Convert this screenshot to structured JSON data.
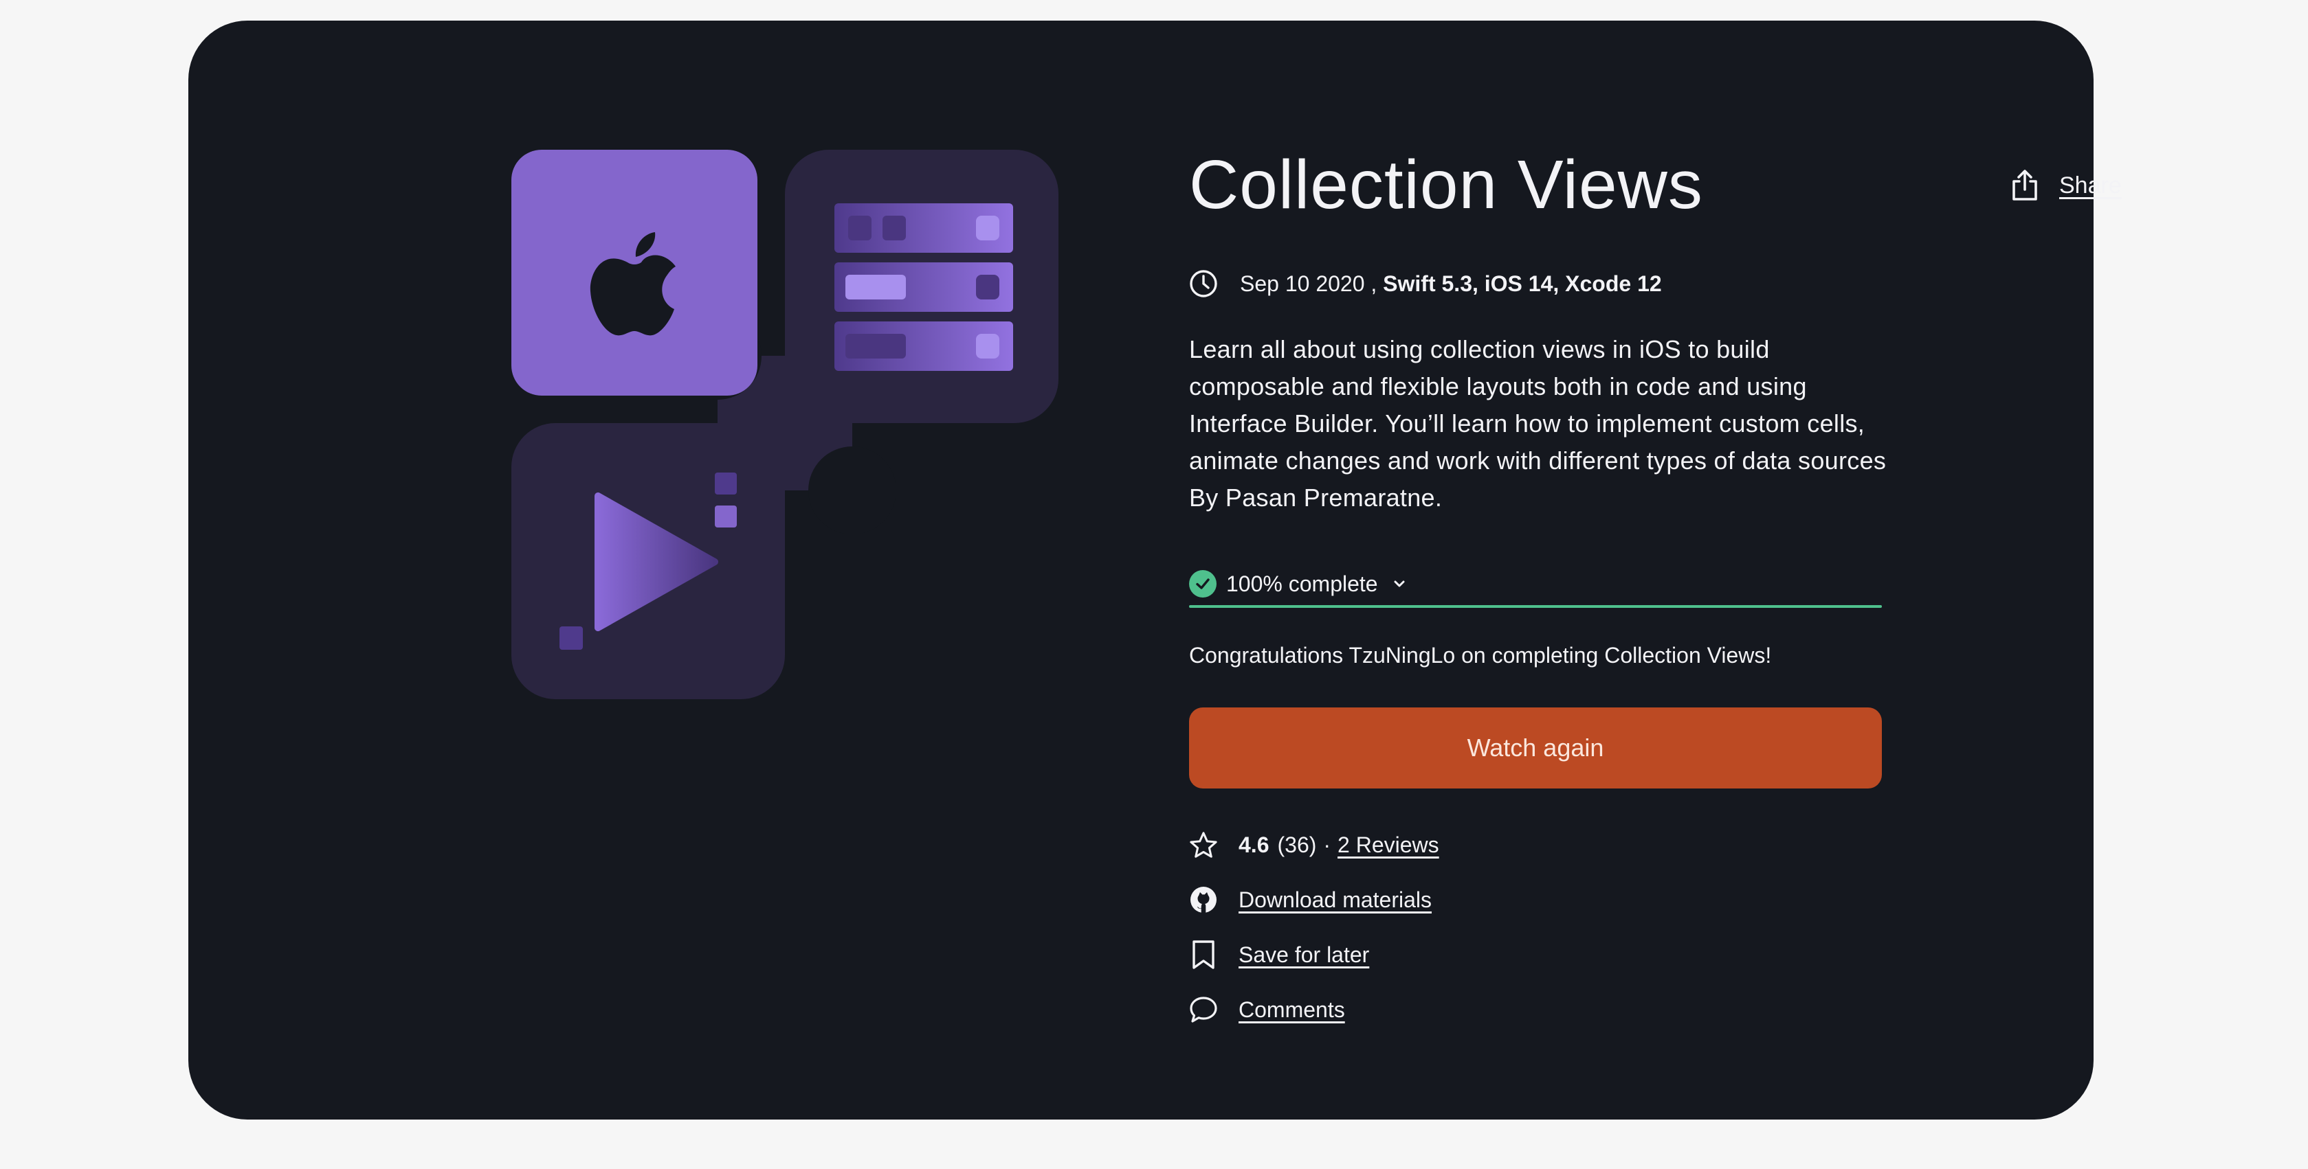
{
  "course": {
    "title": "Collection Views",
    "date": "Sep 10 2020",
    "date_separator": " , ",
    "technologies": "Swift 5.3, iOS 14, Xcode 12",
    "description": "Learn all about using collection views in iOS to build composable and flexible layouts both in code and using Interface Builder. You’ll learn how to implement custom cells, animate changes and work with different types of data sources By Pasan Premaratne."
  },
  "share": {
    "label": "Share",
    "icon": "share-icon"
  },
  "progress": {
    "label": "100% complete",
    "percent": 100,
    "icon": "check-circle-icon"
  },
  "congrats_text": "Congratulations TzuNingLo on completing Collection Views!",
  "watch_button": {
    "label": "Watch again"
  },
  "rating": {
    "value": "4.6",
    "count": "(36)",
    "separator": "·",
    "reviews_link": "2 Reviews",
    "icon": "star-icon"
  },
  "actions": {
    "download": {
      "label": "Download materials",
      "icon": "github-icon"
    },
    "save": {
      "label": "Save for later",
      "icon": "bookmark-icon"
    },
    "comments": {
      "label": "Comments",
      "icon": "comment-icon"
    }
  },
  "colors": {
    "page_background": "#f6f6f6",
    "card_background": "#15181f",
    "text": "#f3f3f6",
    "accent_purple": "#8466cc",
    "tile_dark": "#2a2540",
    "progress_green": "#4fc08d",
    "button_orange": "#bc4a23"
  }
}
